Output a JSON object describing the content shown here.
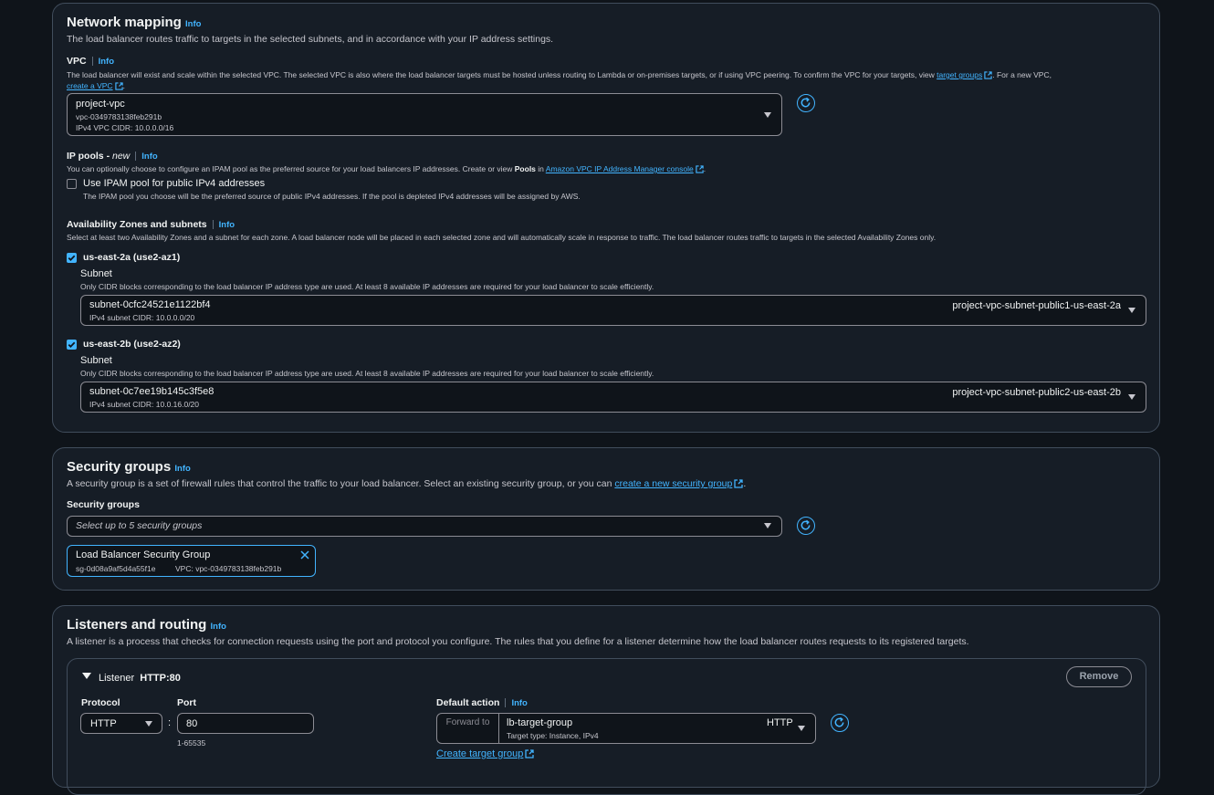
{
  "network": {
    "title": "Network mapping",
    "info": "Info",
    "desc": "The load balancer routes traffic to targets in the selected subnets, and in accordance with your IP address settings.",
    "vpc_label": "VPC",
    "vpc_desc_a": "The load balancer will exist and scale within the selected VPC. The selected VPC is also where the load balancer targets must be hosted unless routing to Lambda or on-premises targets, or if using VPC peering. To confirm the VPC for your targets, view",
    "vpc_link_target_groups": "target groups",
    "vpc_desc_b": ". For a new VPC,",
    "vpc_link_create": "create a VPC",
    "vpc_name": "project-vpc",
    "vpc_id": "vpc-0349783138feb291b",
    "vpc_cidr": "IPv4 VPC CIDR: 10.0.0.0/16",
    "ip_pools_label": "IP pools - ",
    "ip_pools_new": "new",
    "ip_pools_desc_a": "You can optionally choose to configure an IPAM pool as the preferred source for your load balancers IP addresses. Create or view ",
    "ip_pools_desc_bold": "Pools",
    "ip_pools_desc_b": " in ",
    "ip_pools_link": "Amazon VPC IP Address Manager console",
    "ipam_checkbox": "Use IPAM pool for public IPv4 addresses",
    "ipam_desc": "The IPAM pool you choose will be the preferred source of public IPv4 addresses. If the pool is depleted IPv4 addresses will be assigned by AWS.",
    "az_label": "Availability Zones and subnets",
    "az_desc": "Select at least two Availability Zones and a subnet for each zone. A load balancer node will be placed in each selected zone and will automatically scale in response to traffic. The load balancer routes traffic to targets in the selected Availability Zones only.",
    "zones": [
      {
        "name": "us-east-2a (use2-az1)",
        "subnet_label": "Subnet",
        "subnet_desc": "Only CIDR blocks corresponding to the load balancer IP address type are used. At least 8 available IP addresses are required for your load balancer to scale efficiently.",
        "subnet_id": "subnet-0cfc24521e1122bf4",
        "subnet_cidr": "IPv4 subnet CIDR: 10.0.0.0/20",
        "subnet_name": "project-vpc-subnet-public1-us-east-2a"
      },
      {
        "name": "us-east-2b (use2-az2)",
        "subnet_label": "Subnet",
        "subnet_desc": "Only CIDR blocks corresponding to the load balancer IP address type are used. At least 8 available IP addresses are required for your load balancer to scale efficiently.",
        "subnet_id": "subnet-0c7ee19b145c3f5e8",
        "subnet_cidr": "IPv4 subnet CIDR: 10.0.16.0/20",
        "subnet_name": "project-vpc-subnet-public2-us-east-2b"
      }
    ]
  },
  "security": {
    "title": "Security groups",
    "info": "Info",
    "desc": "A security group is a set of firewall rules that control the traffic to your load balancer. Select an existing security group, or you can",
    "desc_link": "create a new security group",
    "label": "Security groups",
    "placeholder": "Select up to 5 security groups",
    "token_name": "Load Balancer Security Group",
    "token_id": "sg-0d08a9af5d4a55f1e",
    "token_vpc": "VPC: vpc-0349783138feb291b"
  },
  "listeners": {
    "title": "Listeners and routing",
    "info": "Info",
    "desc": "A listener is a process that checks for connection requests using the port and protocol you configure. The rules that you define for a listener determine how the load balancer routes requests to its registered targets.",
    "listener_label": "Listener",
    "listener_value": "HTTP:80",
    "remove": "Remove",
    "protocol_label": "Protocol",
    "protocol_value": "HTTP",
    "port_label": "Port",
    "port_value": "80",
    "port_hint": "1-65535",
    "default_action_label": "Default action",
    "forward_to": "Forward to",
    "target_group": "lb-target-group",
    "target_type": "Target type: Instance, IPv4",
    "target_protocol": "HTTP",
    "create_target_group": "Create target group"
  }
}
